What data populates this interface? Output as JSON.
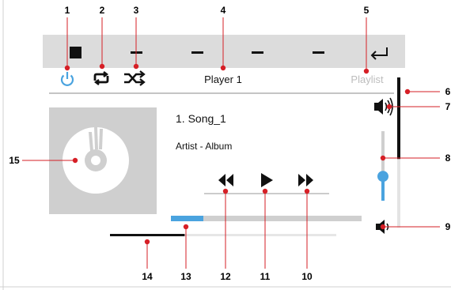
{
  "colors": {
    "accent": "#4aa3df",
    "callout": "#d61f26",
    "panel": "#dcdcdc",
    "art_bg": "#cfcfcf",
    "track": "#cfcfcf",
    "muted_text": "#bdbdbd"
  },
  "player": {
    "title": "Player 1",
    "playlist_label": "Playlist",
    "song_title": "1. Song_1",
    "artist_album": "Artist - Album"
  },
  "icons": {
    "stop": "stop-icon",
    "preset_dash": "dash-icon",
    "back": "return-icon",
    "power": "power-icon",
    "repeat": "repeat-icon",
    "shuffle": "shuffle-icon",
    "volume_loud": "speaker-loud-icon",
    "volume_quiet": "speaker-quiet-icon",
    "album_art": "disc-icon",
    "rewind": "rewind-icon",
    "play": "play-icon",
    "fast_forward": "fast-forward-icon"
  },
  "levels": {
    "playback_progress": 0.17,
    "volume": 0.35,
    "volume_rail_active_fraction": 0.3,
    "channel_level": 0.33
  },
  "callouts": [
    "1",
    "2",
    "3",
    "4",
    "5",
    "6",
    "7",
    "8",
    "9",
    "10",
    "11",
    "12",
    "13",
    "14",
    "15"
  ]
}
